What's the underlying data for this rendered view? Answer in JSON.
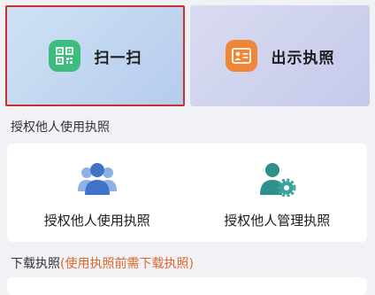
{
  "quick_actions": {
    "scan_label": "扫一扫",
    "show_license_label": "出示执照"
  },
  "authorize_section": {
    "title": "授权他人使用执照",
    "items": [
      {
        "label": "授权他人使用执照",
        "icon": "users-group-icon"
      },
      {
        "label": "授权他人管理执照",
        "icon": "user-settings-icon"
      }
    ]
  },
  "download_section": {
    "title": "下载执照",
    "note": "(使用执照前需下载执照)"
  },
  "colors": {
    "accent_red": "#c8312f",
    "scan_icon_bg": "#3dbd7d",
    "license_icon_bg": "#ef8736",
    "user_icon_blue": "#3f72c9",
    "user_icon_teal": "#2f8f8a",
    "note_orange": "#e2662c"
  }
}
